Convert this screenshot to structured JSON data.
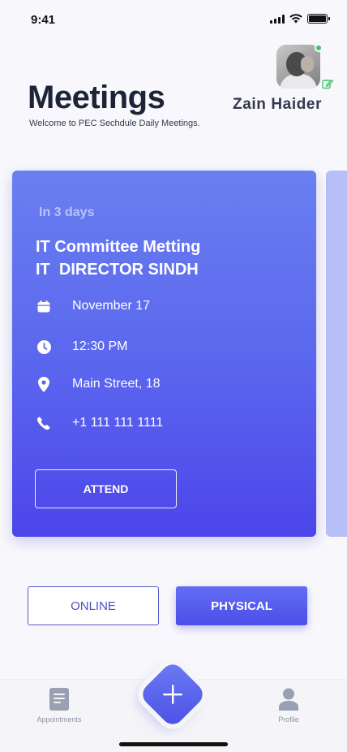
{
  "status_bar": {
    "time": "9:41"
  },
  "header": {
    "title": "Meetings",
    "subtitle": "Welcome to PEC Sechdule Daily Meetings.",
    "user_name": "Zain Haider"
  },
  "meeting_card": {
    "relative_time": "In 3 days",
    "title": "IT Committee Metting\nIT  DIRECTOR SINDH",
    "date": "November 17",
    "time": "12:30 PM",
    "location": "Main Street, 18",
    "phone": "+1 111 111 1111",
    "attend_label": "ATTEND"
  },
  "mode_toggle": {
    "online_label": "ONLINE",
    "physical_label": "PHYSICAL",
    "selected": "PHYSICAL"
  },
  "tab_bar": {
    "appointments_label": "Appointments",
    "profile_label": "Profile"
  },
  "colors": {
    "accent": "#5a65ee",
    "card_gradient_top": "#6a7ff0",
    "card_gradient_bottom": "#4c45ea",
    "online_status": "#40c463"
  },
  "icons": {
    "date": "calendar-icon",
    "time": "clock-icon",
    "location": "location-pin-icon",
    "phone": "phone-icon",
    "edit": "edit-icon",
    "appointments": "document-icon",
    "profile": "person-icon",
    "fab": "plus-icon"
  }
}
